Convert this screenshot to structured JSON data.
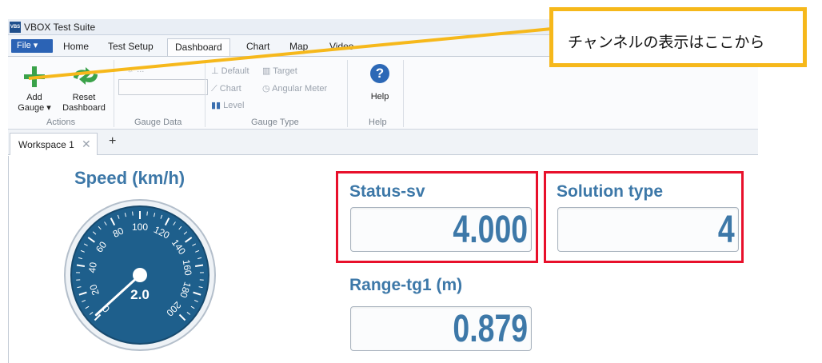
{
  "window": {
    "app_icon_text": "VBS",
    "title": "VBOX Test Suite"
  },
  "menu": {
    "file_label": "File ▾",
    "tabs": [
      "Home",
      "Test Setup",
      "Dashboard",
      "Chart",
      "Map",
      "Video"
    ],
    "active_tab": "Dashboard"
  },
  "ribbon": {
    "add_gauge_label_1": "Add",
    "add_gauge_label_2": "Gauge ▾",
    "reset_label_1": "Reset",
    "reset_label_2": "Dashboard",
    "group_actions": "Actions",
    "group_gauge_data": "Gauge Data",
    "group_gauge_type": "Gauge Type",
    "group_help": "Help",
    "gauge_data_top": "☼ ...",
    "type_default": "Default",
    "type_target": "Target",
    "type_chart": "Chart",
    "type_angular": "Angular Meter",
    "type_level": "Level",
    "help_glyph": "?",
    "help_label": "Help"
  },
  "workspace": {
    "tab_label": "Workspace 1",
    "close_glyph": "✕",
    "add_glyph": "+"
  },
  "dashboard": {
    "speed": {
      "title": "Speed (km/h)",
      "value": 2.0,
      "display": "2.0",
      "ticks": [
        "0",
        "20",
        "40",
        "60",
        "80",
        "100",
        "120",
        "140",
        "160",
        "180",
        "200"
      ],
      "max": 200
    },
    "status_sv": {
      "title": "Status-sv",
      "value": "4.000"
    },
    "solution_type": {
      "title": "Solution type",
      "value": "4"
    },
    "range_tg1": {
      "title": "Range-tg1 (m)",
      "value": "0.879"
    }
  },
  "annotation": {
    "callout_text": "チャンネルの表示はここから"
  },
  "colors": {
    "accent": "#3d78a8",
    "gauge_face": "#1e5f8c",
    "highlight": "#e8102b",
    "callout_border": "#f6b81b",
    "add_green": "#3aa24a"
  }
}
